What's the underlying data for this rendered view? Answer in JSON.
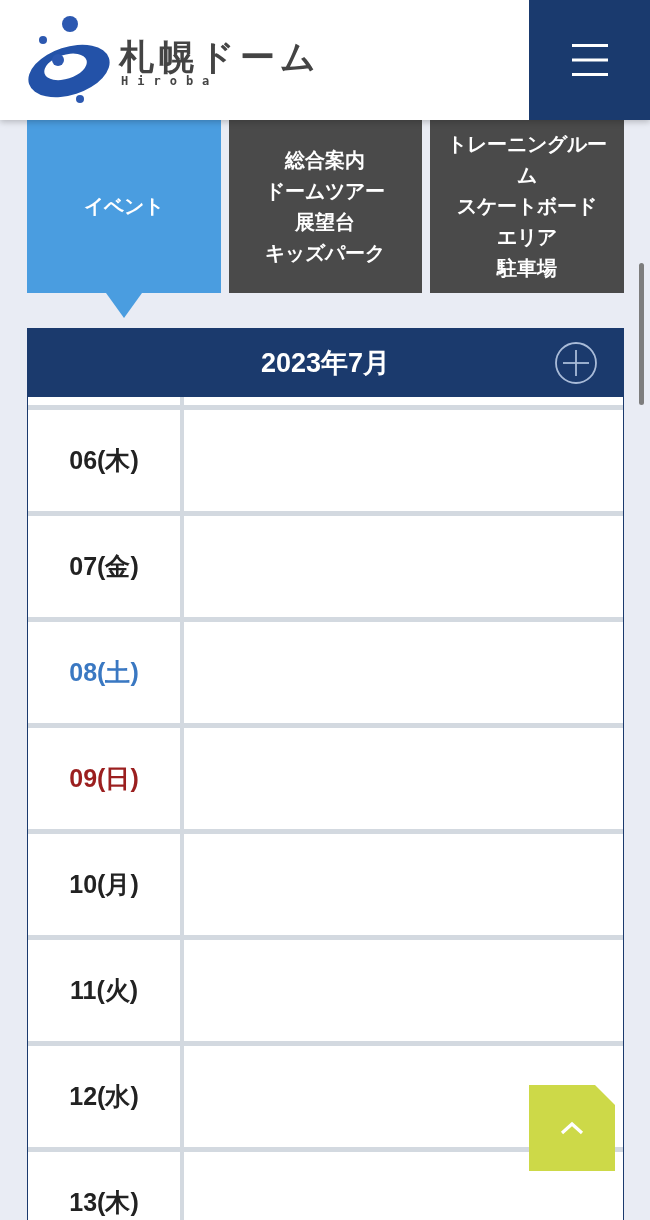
{
  "header": {
    "logo": {
      "name": "札幌ドーム",
      "subtitle": "Hiroba"
    }
  },
  "tabs": [
    {
      "lines": [
        "イベント"
      ],
      "selected": true
    },
    {
      "lines": [
        "総合案内",
        "ドームツアー",
        "展望台",
        "キッズパーク"
      ],
      "selected": false
    },
    {
      "lines": [
        "トレーニングルーム",
        "スケートボード",
        "エリア",
        "駐車場"
      ],
      "selected": false
    }
  ],
  "calendar": {
    "title": "2023年7月",
    "days": [
      {
        "date": "06(木)",
        "color": "#222222"
      },
      {
        "date": "07(金)",
        "color": "#222222"
      },
      {
        "date": "08(土)",
        "color": "#3a78c2"
      },
      {
        "date": "09(日)",
        "color": "#9b1f1f"
      },
      {
        "date": "10(月)",
        "color": "#222222"
      },
      {
        "date": "11(火)",
        "color": "#222222"
      },
      {
        "date": "12(水)",
        "color": "#222222"
      },
      {
        "date": "13(木)",
        "color": "#222222"
      }
    ]
  }
}
